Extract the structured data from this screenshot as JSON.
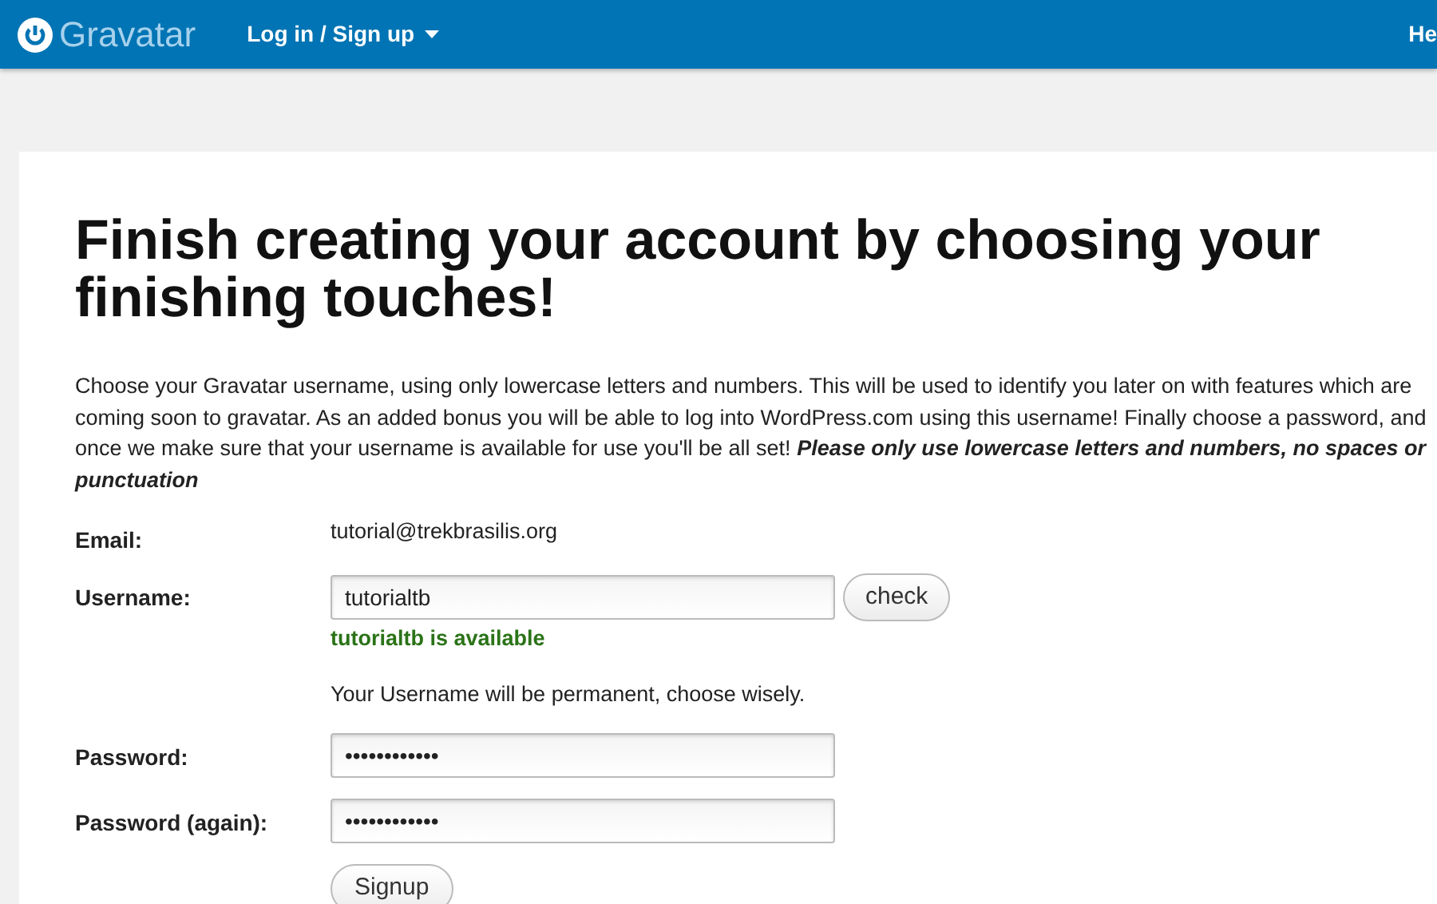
{
  "header": {
    "logo": "Gravatar",
    "menu": "Log in / Sign up",
    "right_link": "He"
  },
  "heading": "Finish creating your account by choosing your finishing touches!",
  "intro": {
    "text": "Choose your Gravatar username, using only lowercase letters and numbers. This will be used to identify you later on with features which are coming soon to gravatar. As an added bonus you will be able to log into WordPress.com using this username! Finally choose a password, and once we make sure that your username is available for use you'll be all set!",
    "emphasis": "Please only use lowercase letters and numbers, no spaces or punctuation"
  },
  "form": [
    {
      "kind": "text",
      "label": "Email:",
      "value": "tutorial@trekbrasilis.org"
    },
    {
      "kind": "input",
      "label": "Username:",
      "value": "tutorialtb",
      "button": "check",
      "status": "tutorialtb is available",
      "hint": "Your Username will be permanent, choose wisely."
    },
    {
      "kind": "input",
      "label": "Password:",
      "value": "••••••••••••"
    },
    {
      "kind": "input",
      "label": "Password (again):",
      "value": "••••••••••••"
    }
  ],
  "submit": "Signup"
}
